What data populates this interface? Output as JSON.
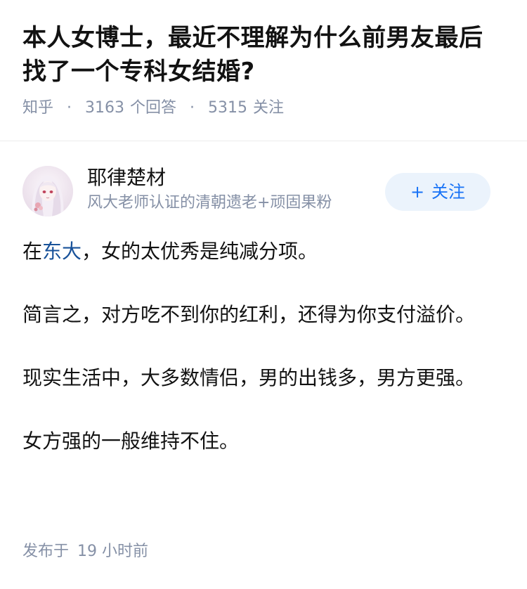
{
  "question": {
    "title": "本人女博士，最近不理解为什么前男友最后找了一个专科女结婚?",
    "source": "知乎",
    "answer_count": "3163",
    "answer_label": "个回答",
    "follower_count": "5315",
    "follower_label": "关注",
    "separator": "·"
  },
  "author": {
    "name": "耶律楚材",
    "description": "风大老师认证的清朝遗老+顽固果粉",
    "avatar_icon": "anime-girl-avatar"
  },
  "follow_button": {
    "icon": "+",
    "label": "关注"
  },
  "answer": {
    "p1_prefix": "在",
    "p1_link": "东大",
    "p1_suffix": "，女的太优秀是纯减分项。",
    "p2": "简言之，对方吃不到你的红利，还得为你支付溢价。",
    "p3": "现实生活中，大多数情侣，男的出钱多，男方更强。",
    "p4": "女方强的一般维持不住。"
  },
  "footer": {
    "published_label": "发布于",
    "published_time": "19 小时前"
  },
  "colors": {
    "meta_gray": "#8590a6",
    "link_blue": "#175199",
    "follow_blue": "#1772f6",
    "follow_bg": "#ebf3fc"
  }
}
